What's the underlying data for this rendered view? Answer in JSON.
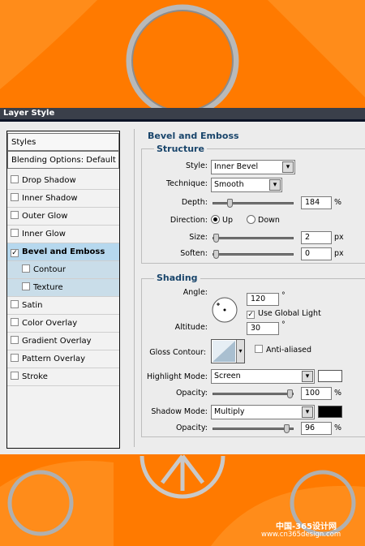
{
  "window": {
    "title": "Layer Style"
  },
  "sidebar": {
    "items": [
      {
        "label": "Styles",
        "checkbox": false,
        "checked": false,
        "type": "boxed"
      },
      {
        "label": "Blending Options: Default",
        "checkbox": false,
        "checked": false,
        "type": "boxed"
      },
      {
        "label": "Drop Shadow",
        "checkbox": true,
        "checked": false,
        "type": "normal"
      },
      {
        "label": "Inner Shadow",
        "checkbox": true,
        "checked": false,
        "type": "normal"
      },
      {
        "label": "Outer Glow",
        "checkbox": true,
        "checked": false,
        "type": "normal"
      },
      {
        "label": "Inner Glow",
        "checkbox": true,
        "checked": false,
        "type": "normal"
      },
      {
        "label": "Bevel and Emboss",
        "checkbox": true,
        "checked": true,
        "type": "active"
      },
      {
        "label": "Contour",
        "checkbox": true,
        "checked": false,
        "type": "sub"
      },
      {
        "label": "Texture",
        "checkbox": true,
        "checked": false,
        "type": "sub"
      },
      {
        "label": "Satin",
        "checkbox": true,
        "checked": false,
        "type": "normal"
      },
      {
        "label": "Color Overlay",
        "checkbox": true,
        "checked": false,
        "type": "normal"
      },
      {
        "label": "Gradient Overlay",
        "checkbox": true,
        "checked": false,
        "type": "normal"
      },
      {
        "label": "Pattern Overlay",
        "checkbox": true,
        "checked": false,
        "type": "normal"
      },
      {
        "label": "Stroke",
        "checkbox": true,
        "checked": false,
        "type": "normal"
      }
    ]
  },
  "bevel": {
    "heading": "Bevel and Emboss",
    "structure": {
      "heading": "Structure",
      "style_label": "Style:",
      "style_value": "Inner Bevel",
      "technique_label": "Technique:",
      "technique_value": "Smooth",
      "depth_label": "Depth:",
      "depth_value": "184",
      "depth_unit": "%",
      "depth_level": 0.184,
      "direction_label": "Direction:",
      "direction_up": "Up",
      "direction_down": "Down",
      "direction_selected": "Up",
      "size_label": "Size:",
      "size_value": "2",
      "size_unit": "px",
      "size_level": 0.0,
      "soften_label": "Soften:",
      "soften_value": "0",
      "soften_unit": "px",
      "soften_level": 0.0
    },
    "shading": {
      "heading": "Shading",
      "angle_label": "Angle:",
      "angle_value": "120",
      "angle_unit": "°",
      "global_light_label": "Use Global Light",
      "global_light_checked": true,
      "altitude_label": "Altitude:",
      "altitude_value": "30",
      "altitude_unit": "°",
      "gloss_label": "Gloss Contour:",
      "anti_aliased_label": "Anti-aliased",
      "anti_aliased_checked": false,
      "highlight_label": "Highlight Mode:",
      "highlight_value": "Screen",
      "highlight_color": "#ffffff",
      "highlight_opacity_label": "Opacity:",
      "highlight_opacity_value": "100",
      "highlight_opacity_unit": "%",
      "highlight_opacity_level": 1.0,
      "shadow_label": "Shadow Mode:",
      "shadow_value": "Multiply",
      "shadow_color": "#000000",
      "shadow_opacity_label": "Opacity:",
      "shadow_opacity_value": "96",
      "shadow_opacity_unit": "%",
      "shadow_opacity_level": 0.96
    }
  },
  "watermark": {
    "line1": "中国-365设计网",
    "line2": "www.cn365design.com"
  },
  "colors": {
    "background": "#ff7a00",
    "accent": "#19456b",
    "selected": "#b6d8ee"
  }
}
